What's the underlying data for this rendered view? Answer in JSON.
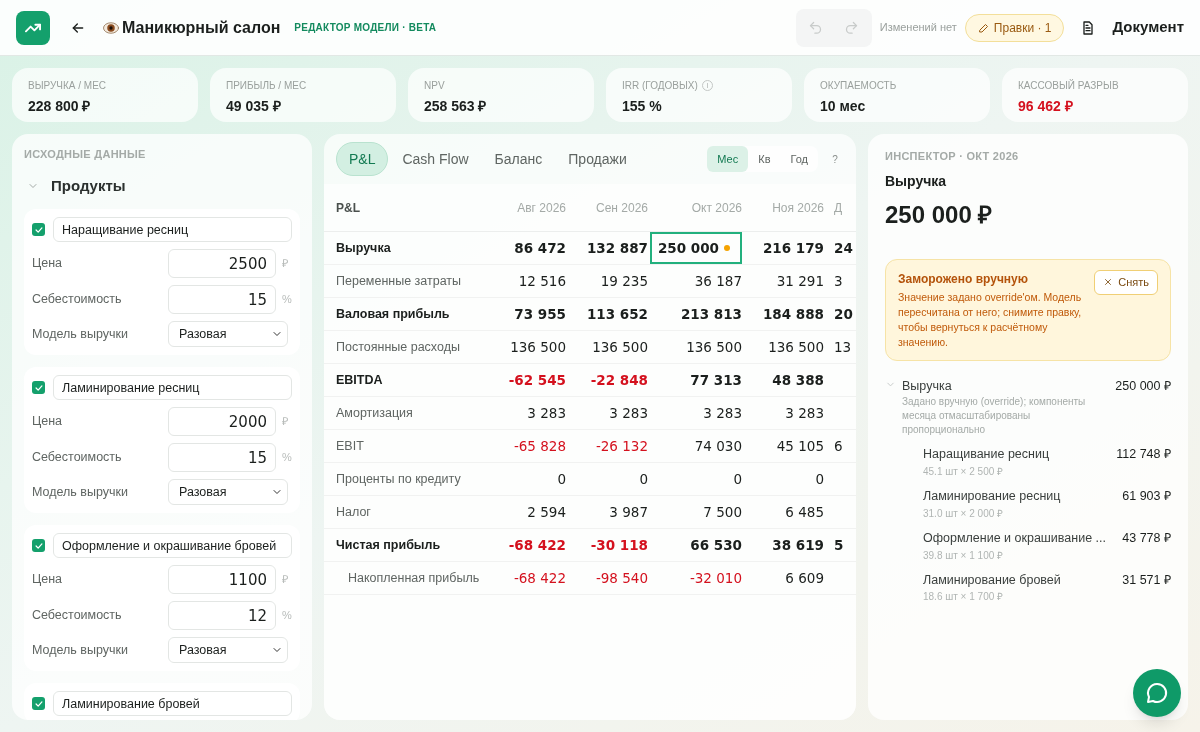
{
  "header": {
    "title": "Маникюрный салон",
    "subtitle": "РЕДАКТОР МОДЕЛИ · BETA",
    "undo_disabled": true,
    "redo_disabled": true,
    "changes_status": "Изменений нет",
    "edits_button": "Правки · 1",
    "document_button": "Документ"
  },
  "kpis": [
    {
      "label": "ВЫРУЧКА / МЕС",
      "value": "228 800 ₽",
      "negative": false,
      "info": false
    },
    {
      "label": "ПРИБЫЛЬ / МЕС",
      "value": "49 035 ₽",
      "negative": false,
      "info": false
    },
    {
      "label": "NPV",
      "value": "258 563 ₽",
      "negative": false,
      "info": false
    },
    {
      "label": "IRR (ГОДОВЫХ)",
      "value": "155 %",
      "negative": false,
      "info": true
    },
    {
      "label": "ОКУПАЕМОСТЬ",
      "value": "10 мес",
      "negative": false,
      "info": false
    },
    {
      "label": "КАССОВЫЙ РАЗРЫВ",
      "value": "96 462 ₽",
      "negative": true,
      "info": false
    }
  ],
  "inputs": {
    "title": "ИСХОДНЫЕ ДАННЫЕ",
    "section": "Продукты",
    "expanded": true,
    "products": [
      {
        "name": "Наращивание ресниц",
        "checked": true,
        "fields": [
          {
            "label": "Цена",
            "kind": "number",
            "value": "2500",
            "unit": "₽"
          },
          {
            "label": "Себестоимость",
            "kind": "number",
            "value": "15",
            "unit": "%"
          },
          {
            "label": "Модель выручки",
            "kind": "select",
            "value": "Разовая"
          }
        ]
      },
      {
        "name": "Ламинирование ресниц",
        "checked": true,
        "fields": [
          {
            "label": "Цена",
            "kind": "number",
            "value": "2000",
            "unit": "₽"
          },
          {
            "label": "Себестоимость",
            "kind": "number",
            "value": "15",
            "unit": "%"
          },
          {
            "label": "Модель выручки",
            "kind": "select",
            "value": "Разовая"
          }
        ]
      },
      {
        "name": "Оформление и окрашивание бровей",
        "checked": true,
        "fields": [
          {
            "label": "Цена",
            "kind": "number",
            "value": "1100",
            "unit": "₽"
          },
          {
            "label": "Себестоимость",
            "kind": "number",
            "value": "12",
            "unit": "%"
          },
          {
            "label": "Модель выручки",
            "kind": "select",
            "value": "Разовая"
          }
        ]
      },
      {
        "name": "Ламинирование бровей",
        "checked": true
      }
    ]
  },
  "report": {
    "tabs": [
      {
        "label": "P&L",
        "selected": true
      },
      {
        "label": "Cash Flow",
        "selected": false
      },
      {
        "label": "Баланс",
        "selected": false
      },
      {
        "label": "Продажи",
        "selected": false
      }
    ],
    "periods": [
      {
        "label": "Мес",
        "selected": true
      },
      {
        "label": "Кв",
        "selected": false
      },
      {
        "label": "Год",
        "selected": false
      }
    ],
    "help": "?",
    "table": {
      "label_header": "P&L",
      "columns": [
        "Авг 2026",
        "Сен 2026",
        "Окт 2026",
        "Ноя 2026",
        "Д"
      ],
      "rows": [
        {
          "label": "Выручка",
          "bold": true,
          "indent": false,
          "cells": [
            {
              "text": "86 472",
              "negative": false,
              "selected": false
            },
            {
              "text": "132 887",
              "negative": false,
              "selected": false
            },
            {
              "text": "250 000",
              "negative": false,
              "selected": true
            },
            {
              "text": "216 179",
              "negative": false,
              "selected": false
            },
            {
              "text": "24",
              "negative": false,
              "selected": false
            }
          ]
        },
        {
          "label": "Переменные затраты",
          "bold": false,
          "indent": false,
          "cells": [
            {
              "text": "12 516",
              "negative": false,
              "selected": false
            },
            {
              "text": "19 235",
              "negative": false,
              "selected": false
            },
            {
              "text": "36 187",
              "negative": false,
              "selected": false
            },
            {
              "text": "31 291",
              "negative": false,
              "selected": false
            },
            {
              "text": "3",
              "negative": false,
              "selected": false
            }
          ]
        },
        {
          "label": "Валовая прибыль",
          "bold": true,
          "indent": false,
          "cells": [
            {
              "text": "73 955",
              "negative": false,
              "selected": false
            },
            {
              "text": "113 652",
              "negative": false,
              "selected": false
            },
            {
              "text": "213 813",
              "negative": false,
              "selected": false
            },
            {
              "text": "184 888",
              "negative": false,
              "selected": false
            },
            {
              "text": "20",
              "negative": false,
              "selected": false
            }
          ]
        },
        {
          "label": "Постоянные расходы",
          "bold": false,
          "indent": false,
          "cells": [
            {
              "text": "136 500",
              "negative": false,
              "selected": false
            },
            {
              "text": "136 500",
              "negative": false,
              "selected": false
            },
            {
              "text": "136 500",
              "negative": false,
              "selected": false
            },
            {
              "text": "136 500",
              "negative": false,
              "selected": false
            },
            {
              "text": "13",
              "negative": false,
              "selected": false
            }
          ]
        },
        {
          "label": "EBITDA",
          "bold": true,
          "indent": false,
          "cells": [
            {
              "text": "-62 545",
              "negative": true,
              "selected": false
            },
            {
              "text": "-22 848",
              "negative": true,
              "selected": false
            },
            {
              "text": "77 313",
              "negative": false,
              "selected": false
            },
            {
              "text": "48 388",
              "negative": false,
              "selected": false
            }
          ]
        },
        {
          "label": "Амортизация",
          "bold": false,
          "indent": false,
          "cells": [
            {
              "text": "3 283",
              "negative": false,
              "selected": false
            },
            {
              "text": "3 283",
              "negative": false,
              "selected": false
            },
            {
              "text": "3 283",
              "negative": false,
              "selected": false
            },
            {
              "text": "3 283",
              "negative": false,
              "selected": false
            }
          ]
        },
        {
          "label": "EBIT",
          "bold": false,
          "indent": false,
          "cells": [
            {
              "text": "-65 828",
              "negative": true,
              "selected": false
            },
            {
              "text": "-26 132",
              "negative": true,
              "selected": false
            },
            {
              "text": "74 030",
              "negative": false,
              "selected": false
            },
            {
              "text": "45 105",
              "negative": false,
              "selected": false
            },
            {
              "text": "6",
              "negative": false,
              "selected": false
            }
          ]
        },
        {
          "label": "Проценты по кредиту",
          "bold": false,
          "indent": false,
          "cells": [
            {
              "text": "0",
              "negative": false,
              "selected": false
            },
            {
              "text": "0",
              "negative": false,
              "selected": false
            },
            {
              "text": "0",
              "negative": false,
              "selected": false
            },
            {
              "text": "0",
              "negative": false,
              "selected": false
            }
          ]
        },
        {
          "label": "Налог",
          "bold": false,
          "indent": false,
          "cells": [
            {
              "text": "2 594",
              "negative": false,
              "selected": false
            },
            {
              "text": "3 987",
              "negative": false,
              "selected": false
            },
            {
              "text": "7 500",
              "negative": false,
              "selected": false
            },
            {
              "text": "6 485",
              "negative": false,
              "selected": false
            }
          ]
        },
        {
          "label": "Чистая прибыль",
          "bold": true,
          "indent": false,
          "cells": [
            {
              "text": "-68 422",
              "negative": true,
              "selected": false
            },
            {
              "text": "-30 118",
              "negative": true,
              "selected": false
            },
            {
              "text": "66 530",
              "negative": false,
              "selected": false
            },
            {
              "text": "38 619",
              "negative": false,
              "selected": false
            },
            {
              "text": "5",
              "negative": false,
              "selected": false
            }
          ]
        },
        {
          "label": "Накопленная прибыль",
          "bold": false,
          "indent": true,
          "cells": [
            {
              "text": "-68 422",
              "negative": true,
              "selected": false
            },
            {
              "text": "-98 540",
              "negative": true,
              "selected": false
            },
            {
              "text": "-32 010",
              "negative": true,
              "selected": false
            },
            {
              "text": "6 609",
              "negative": false,
              "selected": false
            }
          ]
        }
      ]
    }
  },
  "inspector": {
    "caption": "ИНСПЕКТОР · ОКТ 2026",
    "metric": "Выручка",
    "value": "250 000 ₽",
    "alert": {
      "title": "Заморожено вручную",
      "text": "Значение задано override'ом. Модель пересчитана от него; снимите правку, чтобы вернуться к расчётному значению.",
      "button": "Снять"
    },
    "breakdown": {
      "label": "Выручка",
      "value": "250 000 ₽",
      "note": "Задано вручную (override); компоненты месяца отмасштабированы пропорционально",
      "expanded": true,
      "children": [
        {
          "label": "Наращивание ресниц",
          "detail": "45.1 шт × 2 500 ₽",
          "value": "112 748 ₽"
        },
        {
          "label": "Ламинирование ресниц",
          "detail": "31.0 шт × 2 000 ₽",
          "value": "61 903 ₽"
        },
        {
          "label": "Оформление и окрашивание ...",
          "detail": "39.8 шт × 1 100 ₽",
          "value": "43 778 ₽"
        },
        {
          "label": "Ламинирование бровей",
          "detail": "18.6 шт × 1 700 ₽",
          "value": "31 571 ₽"
        }
      ]
    }
  }
}
